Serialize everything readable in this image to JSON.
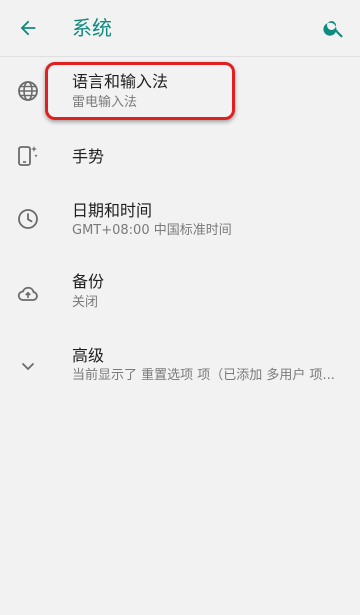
{
  "header": {
    "title": "系统",
    "back_icon": "arrow-left-icon",
    "search_icon": "search-icon",
    "accent_color": "#0f8a7e"
  },
  "items": [
    {
      "title": "语言和输入法",
      "subtitle": "雷电输入法",
      "icon": "globe-icon"
    },
    {
      "title": "手势",
      "subtitle": "",
      "icon": "phone-sparkle-icon"
    },
    {
      "title": "日期和时间",
      "subtitle": "GMT+08:00 中国标准时间",
      "icon": "clock-icon"
    },
    {
      "title": "备份",
      "subtitle": "关闭",
      "icon": "cloud-upload-icon"
    },
    {
      "title": "高级",
      "subtitle": "当前显示了 重置选项 项（已添加 多用户 项...",
      "icon": "chevron-down-icon"
    }
  ],
  "highlight_color": "#e21f1f"
}
